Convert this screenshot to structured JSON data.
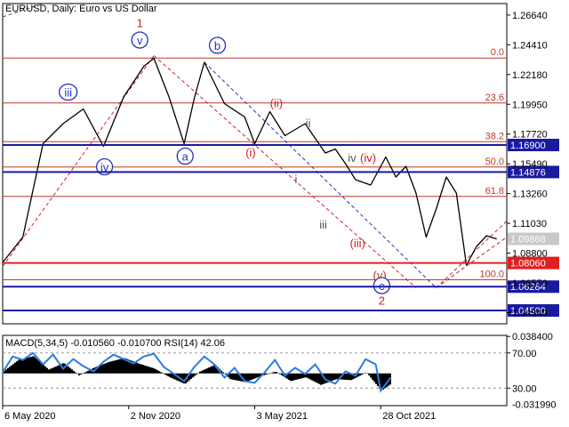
{
  "header": {
    "symbol_line": "EURUSD, Daily:  Euro vs US Dollar",
    "indicator_line": "MACD(5,34,5) -0.010560 -0.010700 RSI(14) 42.06"
  },
  "chart_data": {
    "type": "line",
    "price_axis": {
      "ticks": [
        "1.26640",
        "1.24410",
        "1.22180",
        "1.19950",
        "1.17720",
        "1.15490",
        "1.13260",
        "1.11030",
        "1.08800",
        "1.06570",
        "1.04340"
      ],
      "tick_values": [
        1.2664,
        1.2441,
        1.2218,
        1.1995,
        1.1772,
        1.1549,
        1.1326,
        1.1103,
        1.088,
        1.0657,
        1.0434
      ],
      "range": [
        1.035,
        1.275
      ]
    },
    "x_axis": {
      "labels": [
        "6 May 2020",
        "2 Nov 2020",
        "3 May 2021",
        "28 Oct 2021"
      ],
      "positions": [
        0.0,
        0.25,
        0.5,
        0.75
      ]
    },
    "price_series": {
      "name": "EURUSD",
      "x": [
        0.0,
        0.04,
        0.08,
        0.12,
        0.16,
        0.2,
        0.24,
        0.28,
        0.3,
        0.33,
        0.36,
        0.38,
        0.4,
        0.44,
        0.48,
        0.5,
        0.53,
        0.56,
        0.6,
        0.62,
        0.64,
        0.66,
        0.68,
        0.7,
        0.73,
        0.76,
        0.78,
        0.8,
        0.82,
        0.84,
        0.86,
        0.88,
        0.9,
        0.92,
        0.94,
        0.96,
        0.98
      ],
      "values": [
        1.081,
        1.1,
        1.17,
        1.185,
        1.196,
        1.168,
        1.205,
        1.228,
        1.234,
        1.205,
        1.17,
        1.204,
        1.231,
        1.2,
        1.19,
        1.17,
        1.194,
        1.176,
        1.185,
        1.174,
        1.163,
        1.166,
        1.155,
        1.143,
        1.139,
        1.16,
        1.145,
        1.153,
        1.133,
        1.1,
        1.121,
        1.145,
        1.133,
        1.079,
        1.093,
        1.101,
        1.0986
      ]
    },
    "price_levels": [
      {
        "value": 1.169,
        "label": "1.16900",
        "color": "#1a1aa0"
      },
      {
        "value": 1.14876,
        "label": "1.14876",
        "color": "#1a1aa0"
      },
      {
        "value": 1.0806,
        "label": "1.08060",
        "color": "#e02020"
      },
      {
        "value": 1.06284,
        "label": "1.06284",
        "color": "#1a1aa0"
      },
      {
        "value": 1.045,
        "label": "1.04500",
        "color": "#1a1aa0"
      }
    ],
    "current_price": {
      "value": 1.09868,
      "label": "1.09868"
    },
    "fib_levels": [
      {
        "label": "0.0",
        "value": 1.2342
      },
      {
        "label": "23.6",
        "value": 1.2005
      },
      {
        "label": "38.2",
        "value": 1.1715
      },
      {
        "label": "50.0",
        "value": 1.1525
      },
      {
        "label": "61.8",
        "value": 1.1305
      },
      {
        "label": "100.0",
        "value": 1.068
      }
    ],
    "wave_labels": [
      {
        "text": "1",
        "x": 0.272,
        "y": 1.258,
        "color": "red",
        "circled": false
      },
      {
        "text": "v",
        "x": 0.272,
        "y": 1.245,
        "color": "blue",
        "circled": true
      },
      {
        "text": "iii",
        "x": 0.13,
        "y": 1.206,
        "color": "blue",
        "circled": true
      },
      {
        "text": "iv",
        "x": 0.202,
        "y": 1.15,
        "color": "blue",
        "circled": true
      },
      {
        "text": "a",
        "x": 0.362,
        "y": 1.158,
        "color": "blue",
        "circled": true
      },
      {
        "text": "b",
        "x": 0.426,
        "y": 1.241,
        "color": "blue",
        "circled": true
      },
      {
        "text": "(i)",
        "x": 0.492,
        "y": 1.161,
        "color": "red",
        "circled": false
      },
      {
        "text": "(ii)",
        "x": 0.543,
        "y": 1.198,
        "color": "red",
        "circled": false
      },
      {
        "text": "ii",
        "x": 0.606,
        "y": 1.183,
        "color": "gray",
        "circled": false
      },
      {
        "text": "i",
        "x": 0.582,
        "y": 1.141,
        "color": "gray",
        "circled": false
      },
      {
        "text": "iii",
        "x": 0.636,
        "y": 1.107,
        "color": "gray",
        "circled": false
      },
      {
        "text": "iv",
        "x": 0.693,
        "y": 1.157,
        "color": "gray",
        "circled": false
      },
      {
        "text": "(iv)",
        "x": 0.725,
        "y": 1.157,
        "color": "red",
        "circled": false
      },
      {
        "text": "(iii)",
        "x": 0.704,
        "y": 1.093,
        "color": "red",
        "circled": false
      },
      {
        "text": "(v)",
        "x": 0.748,
        "y": 1.069,
        "color": "red",
        "circled": false
      },
      {
        "text": "c",
        "x": 0.752,
        "y": 1.061,
        "color": "blue",
        "circled": true
      },
      {
        "text": "2",
        "x": 0.752,
        "y": 1.05,
        "color": "red",
        "circled": false
      }
    ],
    "macd_axis": {
      "ticks": [
        "0.038400",
        "-0.031990"
      ],
      "tick_values": [
        0.0384,
        -0.03199
      ],
      "range": [
        -0.0335,
        0.0395
      ]
    },
    "rsi_axis": {
      "ticks": [
        "70.00",
        "30.00"
      ],
      "tick_values": [
        70,
        30
      ],
      "range": [
        10,
        90
      ]
    },
    "macd_series": {
      "name": "MACD",
      "x": [
        0.0,
        0.03,
        0.06,
        0.09,
        0.12,
        0.15,
        0.18,
        0.21,
        0.24,
        0.27,
        0.3,
        0.33,
        0.36,
        0.39,
        0.42,
        0.45,
        0.48,
        0.51,
        0.54,
        0.57,
        0.6,
        0.63,
        0.66,
        0.69,
        0.72,
        0.75,
        0.77
      ],
      "values": [
        0.002,
        0.014,
        0.018,
        0.004,
        0.011,
        -0.002,
        0.006,
        0.012,
        0.016,
        0.01,
        0.005,
        -0.004,
        -0.011,
        0.002,
        0.009,
        -0.006,
        -0.009,
        -0.003,
        0.002,
        -0.008,
        -0.004,
        -0.012,
        -0.006,
        -0.007,
        0.001,
        -0.018,
        -0.01056
      ]
    },
    "rsi_series": {
      "name": "RSI",
      "x": [
        0.0,
        0.02,
        0.04,
        0.06,
        0.08,
        0.1,
        0.12,
        0.14,
        0.16,
        0.18,
        0.2,
        0.22,
        0.24,
        0.26,
        0.28,
        0.3,
        0.32,
        0.34,
        0.36,
        0.38,
        0.4,
        0.42,
        0.44,
        0.46,
        0.48,
        0.5,
        0.52,
        0.54,
        0.56,
        0.58,
        0.6,
        0.62,
        0.64,
        0.66,
        0.68,
        0.7,
        0.72,
        0.74,
        0.75,
        0.77
      ],
      "values": [
        48,
        66,
        62,
        70,
        57,
        68,
        52,
        63,
        55,
        49,
        60,
        68,
        63,
        58,
        66,
        69,
        54,
        46,
        38,
        54,
        66,
        57,
        42,
        53,
        38,
        36,
        48,
        62,
        44,
        53,
        46,
        57,
        40,
        35,
        49,
        44,
        63,
        57,
        27,
        42.06
      ]
    }
  },
  "colors": {
    "fib_line": "#c0392b",
    "wave_red": "#cc2222",
    "wave_blue": "#2233bb",
    "level_blue": "#1a1aa0",
    "level_red": "#e02020",
    "rsi_line": "#2a7de1",
    "macd_hist": "#000000"
  }
}
